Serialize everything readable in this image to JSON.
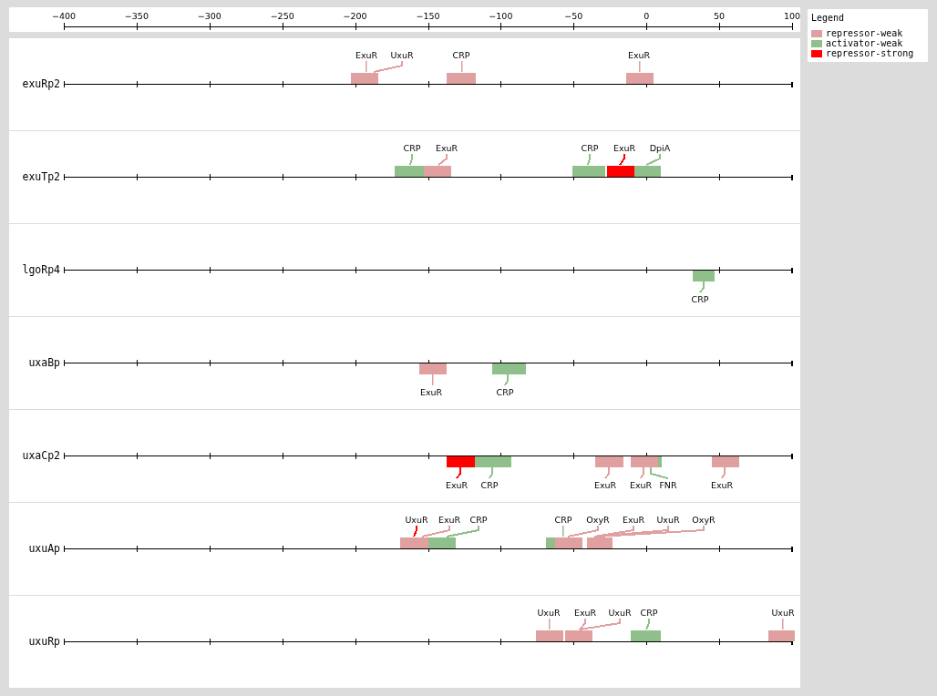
{
  "scale": {
    "ticks": [
      "−400",
      "−350",
      "−300",
      "−250",
      "−200",
      "−150",
      "−100",
      "−50",
      "0",
      "50",
      "100"
    ]
  },
  "legend": {
    "title": "Legend",
    "items": [
      {
        "label": "repressor-weak",
        "color": "#e0a0a0"
      },
      {
        "label": "activator-weak",
        "color": "#8fbf8b"
      },
      {
        "label": "repressor-strong",
        "color": "#ff0000"
      }
    ]
  },
  "tracks": [
    {
      "name": "exuRp2",
      "sites": [
        {
          "color": "#e0a0a0"
        },
        {
          "color": "#e0a0a0"
        },
        {
          "color": "#e0a0a0"
        }
      ],
      "labels": [
        {
          "text": "ExuR",
          "color": "#e0a0a0"
        },
        {
          "text": "UxuR",
          "color": "#e0a0a0"
        },
        {
          "text": "CRP",
          "color": "#e0a0a0"
        },
        {
          "text": "ExuR",
          "color": "#e0a0a0"
        }
      ]
    },
    {
      "name": "exuTp2",
      "sites": [
        {
          "color": "#8fbf8b"
        },
        {
          "color": "#e0a0a0"
        },
        {
          "color": "#8fbf8b"
        },
        {
          "color": "#ff0000"
        },
        {
          "color": "#8fbf8b"
        }
      ],
      "labels": [
        {
          "text": "CRP",
          "color": "#8fbf8b"
        },
        {
          "text": "ExuR",
          "color": "#e0a0a0"
        },
        {
          "text": "CRP",
          "color": "#8fbf8b"
        },
        {
          "text": "ExuR",
          "color": "#ff0000"
        },
        {
          "text": "DpiA",
          "color": "#8fbf8b"
        }
      ]
    },
    {
      "name": "lgoRp4",
      "sites": [
        {
          "color": "#8fbf8b"
        }
      ],
      "labels": [
        {
          "text": "CRP",
          "color": "#8fbf8b"
        }
      ]
    },
    {
      "name": "uxaBp",
      "sites": [
        {
          "color": "#e0a0a0"
        },
        {
          "color": "#8fbf8b"
        }
      ],
      "labels": [
        {
          "text": "ExuR",
          "color": "#e0a0a0"
        },
        {
          "text": "CRP",
          "color": "#8fbf8b"
        }
      ]
    },
    {
      "name": "uxaCp2",
      "sites": [
        {
          "color": "#ff0000"
        },
        {
          "color": "#8fbf8b"
        },
        {
          "color": "#e0a0a0"
        },
        {
          "color": "#e0a0a0"
        },
        {
          "color": "#8fbf8b"
        },
        {
          "color": "#e0a0a0"
        }
      ],
      "labels": [
        {
          "text": "ExuR",
          "color": "#ff0000"
        },
        {
          "text": "CRP",
          "color": "#8fbf8b"
        },
        {
          "text": "ExuR",
          "color": "#e0a0a0"
        },
        {
          "text": "ExuR",
          "color": "#e0a0a0"
        },
        {
          "text": "FNR",
          "color": "#8fbf8b"
        },
        {
          "text": "ExuR",
          "color": "#e0a0a0"
        }
      ]
    },
    {
      "name": "uxuAp",
      "sites": [
        {
          "color": "#e0a0a0"
        },
        {
          "color": "#8fbf8b"
        },
        {
          "color": "#8fbf8b"
        },
        {
          "color": "#e0a0a0"
        },
        {
          "color": "#e0a0a0"
        }
      ],
      "labels": [
        {
          "text": "UxuR",
          "color": "#ff0000"
        },
        {
          "text": "ExuR",
          "color": "#e0a0a0"
        },
        {
          "text": "CRP",
          "color": "#8fbf8b"
        },
        {
          "text": "CRP",
          "color": "#8fbf8b"
        },
        {
          "text": "OxyR",
          "color": "#e0a0a0"
        },
        {
          "text": "ExuR",
          "color": "#e0a0a0"
        },
        {
          "text": "UxuR",
          "color": "#e0a0a0"
        },
        {
          "text": "OxyR",
          "color": "#e0a0a0"
        }
      ]
    },
    {
      "name": "uxuRp",
      "sites": [
        {
          "color": "#e0a0a0"
        },
        {
          "color": "#e0a0a0"
        },
        {
          "color": "#8fbf8b"
        },
        {
          "color": "#e0a0a0"
        }
      ],
      "labels": [
        {
          "text": "UxuR",
          "color": "#e0a0a0"
        },
        {
          "text": "ExuR",
          "color": "#e0a0a0"
        },
        {
          "text": "UxuR",
          "color": "#e0a0a0"
        },
        {
          "text": "CRP",
          "color": "#8fbf8b"
        },
        {
          "text": "UxuR",
          "color": "#e0a0a0"
        }
      ]
    }
  ]
}
